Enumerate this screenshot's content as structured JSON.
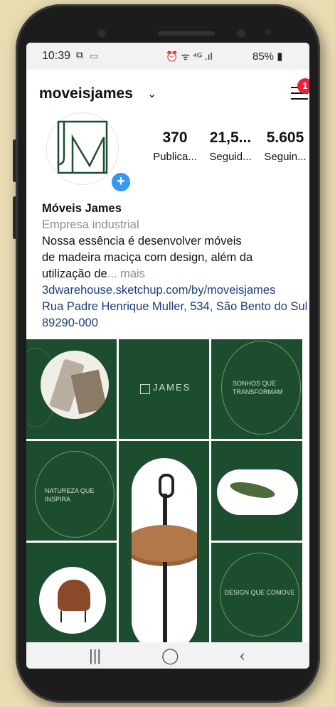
{
  "status_bar": {
    "time": "10:39",
    "left_icons": "⧉ ▭",
    "right_icons": "⏰ ᯤ ⁴ᴳ .ıl",
    "battery": "85%"
  },
  "profile": {
    "username": "moveisjames",
    "notification_count": "1",
    "stats": [
      {
        "value": "370",
        "label": "Publica..."
      },
      {
        "value": "21,5...",
        "label": "Seguid..."
      },
      {
        "value": "5.605",
        "label": "Seguin..."
      }
    ],
    "name": "Móveis James",
    "category": "Empresa industrial",
    "bio_line1": "Nossa essência é desenvolver móveis",
    "bio_line2": "de madeira maciça com design, além da",
    "bio_line3": "utilização de",
    "more": "... mais",
    "website": "3dwarehouse.sketchup.com/by/moveisjames",
    "address": "Rua Padre Henrique Muller, 534, São Bento do Sul 89290-000"
  },
  "posts": {
    "brand": "JAMES",
    "sonhos": "SONHOS QUE TRANSFORMAM",
    "natureza": "NATUREZA QUE INSPIRA",
    "design": "DESIGN QUE COMOVE"
  },
  "nav_icons": [
    "recent-apps",
    "home",
    "back"
  ],
  "colors": {
    "tile_green": "#1b4d2e",
    "notif_red": "#e8223b",
    "link_blue": "#1b3d7a"
  }
}
